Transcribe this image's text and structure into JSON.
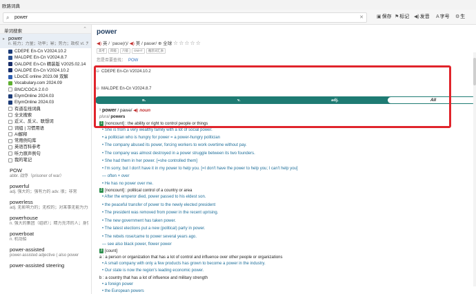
{
  "app": {
    "title": "欧路词典"
  },
  "search": {
    "value": "power",
    "clear": "✕"
  },
  "toolbar": {
    "save": "保存",
    "bookmark": "标记",
    "speak": "发音",
    "font": "字号",
    "more": "生"
  },
  "sidebar": {
    "header": "单词搜索",
    "selected_word": {
      "word": "power",
      "def": "n. 能力；力量；功率；幂；势力；政权 vt. 为…提供动力"
    },
    "dicts": [
      {
        "name": "CDEPE En-Cn V2024.10.2",
        "color": "#1d3c78"
      },
      {
        "name": "MALDPE En-Cn V2024.8.7",
        "color": "#2a4f8f"
      },
      {
        "name": "OALDPE En-Cn 精装版 V2025.02.14",
        "color": "#1a2f6a"
      },
      {
        "name": "OALDPE En-Cn V2024.10.2",
        "color": "#1a2f6a"
      },
      {
        "name": "LDoCE online 2023.08 双解",
        "color": "#2f5fb0"
      },
      {
        "name": "Vocabulary.com 2024.09",
        "color": "#5fb030"
      },
      {
        "name": "BNC/COCA 2.0.0",
        "color": ""
      },
      {
        "name": "EtymOnline 2024.03",
        "color": "#1d3c78"
      },
      {
        "name": "EtymOnline 2024.03",
        "color": "#1d3c78"
      },
      {
        "name": "有道在线词典",
        "color": ""
      },
      {
        "name": "全文搜索",
        "color": ""
      },
      {
        "name": "近义、反义、联想词",
        "color": ""
      },
      {
        "name": "词组 | 习惯用语",
        "color": ""
      },
      {
        "name": "AI解释",
        "color": ""
      },
      {
        "name": "常用例句库",
        "color": ""
      },
      {
        "name": "英语百科参考",
        "color": ""
      },
      {
        "name": "听力原声例句",
        "color": ""
      },
      {
        "name": "我的笔记",
        "color": ""
      }
    ],
    "words": [
      {
        "word": "POW",
        "def": "abbr. 战俘（prisoner of war）"
      },
      {
        "word": "powerful",
        "def": "adj. 强大的；强有力的 adv. 很；非常"
      },
      {
        "word": "powerless",
        "def": "adj. 无影响力的；无权的；对某事无能为力的"
      },
      {
        "word": "powerhouse",
        "def": "n. 强大的集团（组织）；精力充沛的人；身强力壮的人"
      },
      {
        "word": "powerboat",
        "def": "n. 机动船"
      },
      {
        "word": "power-assisted",
        "def": "power-assisted   adjective   ( also  power"
      },
      {
        "word": "power-assisted steering",
        "def": ""
      }
    ]
  },
  "entry": {
    "headword": "power",
    "pron_uk": "英 / ˈpaʊə(r)/",
    "pron_us": "美 / paʊər/",
    "all": "全球",
    "stars": "☆☆☆☆☆",
    "tags": [
      "高考",
      "四级",
      "六级",
      "GMAT",
      "雅思词汇表"
    ],
    "maybe_label": "您是否要查找：",
    "maybe_word": "POW",
    "dict1": "CDEPE En-Cn V2024.10.2",
    "dict2": "MALDPE En-Cn V2024.8.7",
    "tabs": [
      "n.",
      "v.",
      "adj.",
      "All"
    ],
    "pos_word": "power",
    "pos_ipa": "/ pawə/",
    "pos": "noun",
    "plural_label": "plural",
    "plural": "powers",
    "sense1": "[noncount]  : the ability or right to control people or things",
    "lines": [
      "• She is from a very wealthy family with a lot of social power.",
      "• a politician who is hungry for power = a power-hungry politician",
      "• The company abused its power, forcing workers to work overtime without pay.",
      "• The company was almost destroyed in a power struggle between its two founders.",
      "• She had them in her power. [=she controlled them]",
      "• I'm sorry, but I don't have it in my power to help you. [=I don't have the power to help you; I can't help you]",
      "— often + over",
      "• He has no power over me."
    ],
    "sense2_num": "2",
    "sense2": "[noncount]  : political control of a country or area",
    "lines2": [
      "• After the emperor died, power passed to his eldest son.",
      "• the peaceful transfer of power to the newly elected president",
      "• The president was removed from power in the recent uprising.",
      "• The new government has taken power.",
      "• The latest elections put a new (political) party in power.",
      "• The rebels rose/came to power several years ago.",
      "— see also black power, flower power"
    ],
    "sense3_num": "3",
    "sense3": "[count]",
    "sense3a": "a  : a person or organization that has a lot of control and influence over other people or organizations",
    "lines3": [
      "• A small company with only a few products has grown to become a power in the industry.",
      "• Our state is now the region's leading economic power."
    ],
    "sense3b": "b  : a country that has a lot of influence and military strength",
    "lines4": [
      "• a foreign power",
      "• the European powers"
    ]
  }
}
